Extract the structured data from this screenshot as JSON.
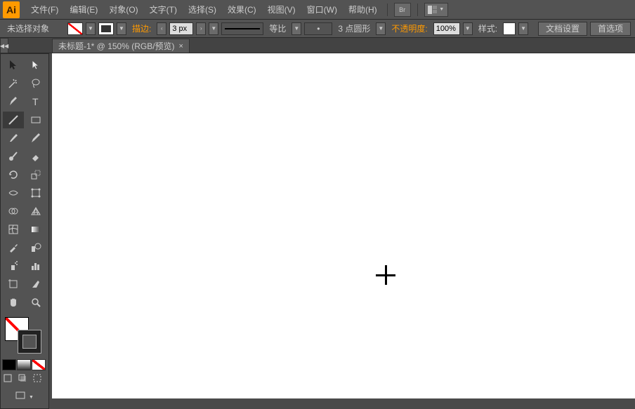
{
  "app": {
    "logo": "Ai"
  },
  "menu": {
    "file": "文件(F)",
    "edit": "编辑(E)",
    "object": "对象(O)",
    "type": "文字(T)",
    "select": "选择(S)",
    "effect": "效果(C)",
    "view": "视图(V)",
    "window": "窗口(W)",
    "help": "帮助(H)",
    "br_label": "Br"
  },
  "control": {
    "selection": "未选择对象",
    "stroke_label": "描边:",
    "stroke_value": "3 px",
    "scale_label": "等比",
    "profile_mark": "•",
    "profile_value": "3 点圆形",
    "opacity_label": "不透明度:",
    "opacity_value": "100%",
    "style_label": "样式:",
    "doc_setup": "文档设置",
    "preferences": "首选项"
  },
  "tab": {
    "title": "未标题-1* @ 150% (RGB/预览)",
    "close": "×"
  },
  "dock_toggle": "◀◀"
}
